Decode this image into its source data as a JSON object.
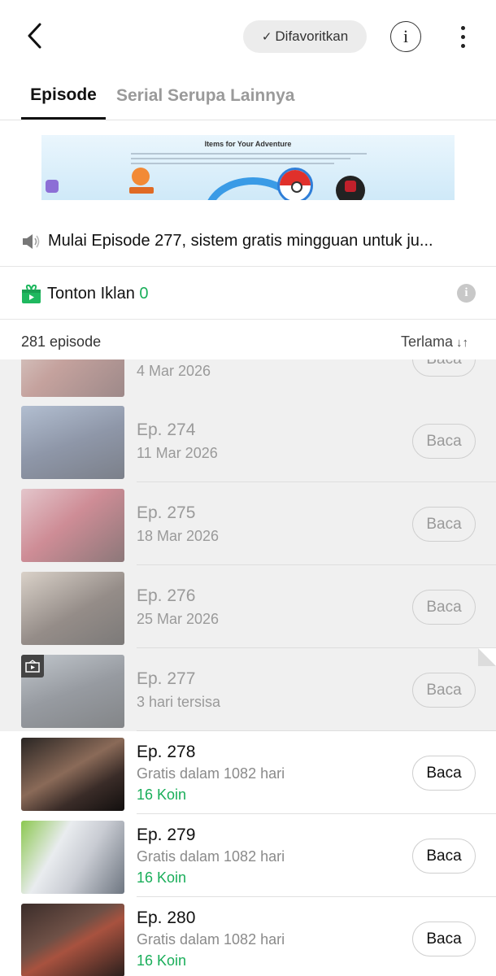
{
  "header": {
    "favorite_label": "Difavoritkan",
    "info_glyph": "i"
  },
  "tabs": [
    {
      "label": "Episode",
      "active": true
    },
    {
      "label": "Serial Serupa Lainnya",
      "active": false
    }
  ],
  "banner": {
    "title": "Items for Your Adventure"
  },
  "notice": {
    "text": "Mulai Episode 277, sistem gratis mingguan untuk ju..."
  },
  "watch_ad": {
    "label": "Tonton Iklan",
    "count": "0"
  },
  "list_header": {
    "count_label": "281 episode",
    "sort_label": "Terlama",
    "sort_glyph": "↓↑"
  },
  "colors": {
    "green": "#1aae5a",
    "read_bg": "#f0f0f0"
  },
  "episodes": [
    {
      "title": "",
      "subtitle": "4 Mar 2026",
      "price": "",
      "button": "Baca",
      "state": "read"
    },
    {
      "title": "Ep. 274",
      "subtitle": "11 Mar 2026",
      "price": "",
      "button": "Baca",
      "state": "read"
    },
    {
      "title": "Ep. 275",
      "subtitle": "18 Mar 2026",
      "price": "",
      "button": "Baca",
      "state": "read"
    },
    {
      "title": "Ep. 276",
      "subtitle": "25 Mar 2026",
      "price": "",
      "button": "Baca",
      "state": "read"
    },
    {
      "title": "Ep. 277",
      "subtitle": "3 hari tersisa",
      "price": "",
      "button": "Baca",
      "state": "read"
    },
    {
      "title": "Ep. 278",
      "subtitle": "Gratis dalam 1082 hari",
      "price": "16 Koin",
      "button": "Baca",
      "state": "locked"
    },
    {
      "title": "Ep. 279",
      "subtitle": "Gratis dalam 1082 hari",
      "price": "16 Koin",
      "button": "Baca",
      "state": "locked"
    },
    {
      "title": "Ep. 280",
      "subtitle": "Gratis dalam 1082 hari",
      "price": "16 Koin",
      "button": "Baca",
      "state": "locked"
    }
  ]
}
